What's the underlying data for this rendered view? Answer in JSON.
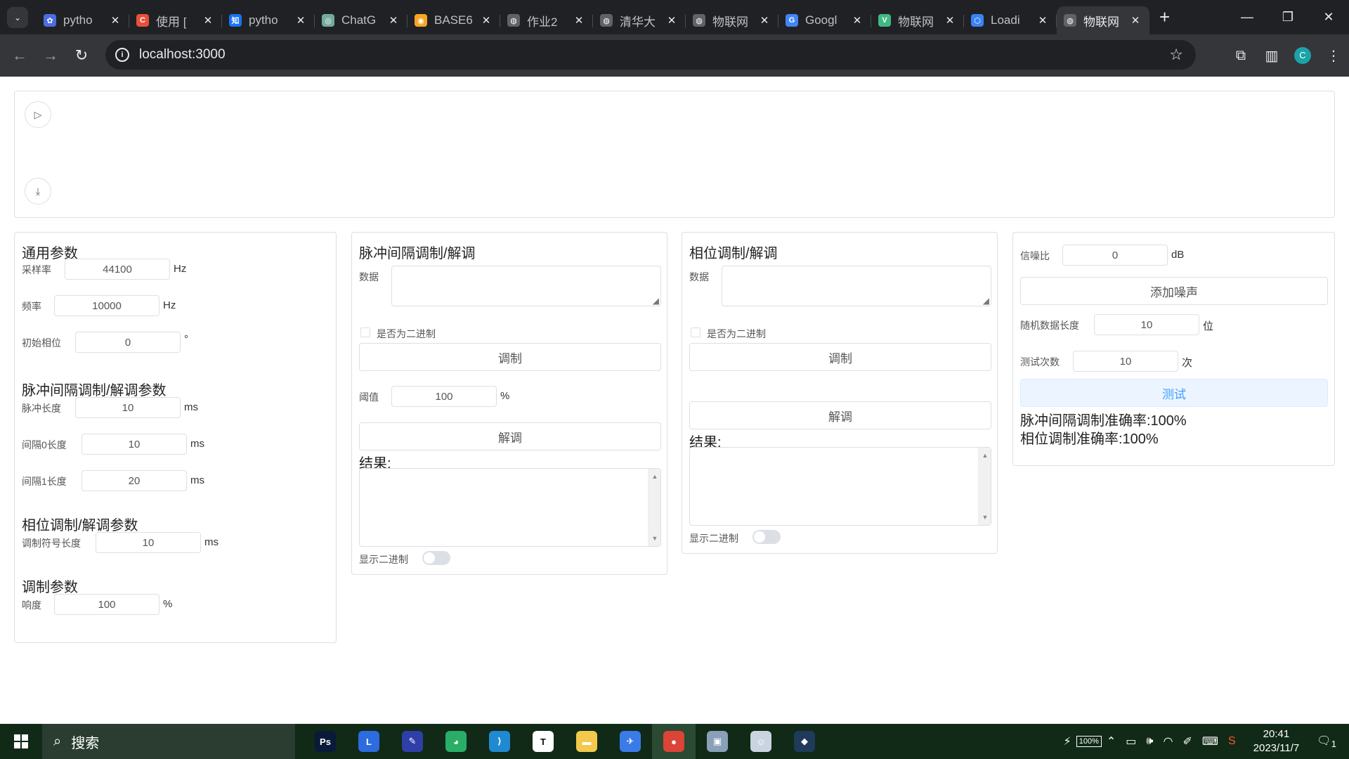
{
  "browser": {
    "tabs": [
      {
        "title": "pytho",
        "icon": "python-icon",
        "color": "#4a6ee0",
        "glyph": "✿",
        "active": false
      },
      {
        "title": "使用 [",
        "icon": "csdn-icon",
        "color": "#e8503a",
        "glyph": "C",
        "active": false
      },
      {
        "title": "pytho",
        "icon": "zhihu-icon",
        "color": "#1772f6",
        "glyph": "知",
        "active": false
      },
      {
        "title": "ChatG",
        "icon": "chatgpt-icon",
        "color": "#74aa9c",
        "glyph": "◎",
        "active": false
      },
      {
        "title": "BASE6",
        "icon": "base64-icon",
        "color": "#f5a623",
        "glyph": "◉",
        "active": false
      },
      {
        "title": "作业2",
        "icon": "globe-icon",
        "color": "#5f6368",
        "glyph": "◍",
        "active": false
      },
      {
        "title": "清华大",
        "icon": "globe-icon",
        "color": "#5f6368",
        "glyph": "◍",
        "active": false
      },
      {
        "title": "物联网",
        "icon": "globe-icon",
        "color": "#5f6368",
        "glyph": "◍",
        "active": false
      },
      {
        "title": "Googl",
        "icon": "google-translate-icon",
        "color": "#4285f4",
        "glyph": "G",
        "active": false
      },
      {
        "title": "物联网",
        "icon": "vue-icon",
        "color": "#41b883",
        "glyph": "V",
        "active": false
      },
      {
        "title": "Loadi",
        "icon": "loading-icon",
        "color": "#3b82f6",
        "glyph": "⬡",
        "active": false
      },
      {
        "title": "物联网",
        "icon": "globe-icon",
        "color": "#5f6368",
        "glyph": "◍",
        "active": true
      }
    ],
    "url": "localhost:3000",
    "profile_initial": "C"
  },
  "general": {
    "title": "通用参数",
    "sample_rate_label": "采样率",
    "sample_rate": "44100",
    "sample_rate_unit": "Hz",
    "freq_label": "频率",
    "freq": "10000",
    "freq_unit": "Hz",
    "phase_label": "初始相位",
    "phase": "0",
    "phase_unit": "°",
    "pulse_title": "脉冲间隔调制/解调参数",
    "pulse_len_label": "脉冲长度",
    "pulse_len": "10",
    "pulse_len_unit": "ms",
    "gap0_label": "间隔0长度",
    "gap0": "10",
    "gap0_unit": "ms",
    "gap1_label": "间隔1长度",
    "gap1": "20",
    "gap1_unit": "ms",
    "phase_title": "相位调制/解调参数",
    "sym_len_label": "调制符号长度",
    "sym_len": "10",
    "sym_len_unit": "ms",
    "mod_title": "调制参数",
    "loud_label": "响度",
    "loud": "100",
    "loud_unit": "%"
  },
  "pulse": {
    "title": "脉冲间隔调制/解调",
    "data_label": "数据",
    "binary_label": "是否为二进制",
    "mod_btn": "调制",
    "thresh_label": "阈值",
    "thresh": "100",
    "thresh_unit": "%",
    "demod_btn": "解调",
    "result_label": "结果:",
    "show_binary": "显示二进制"
  },
  "phase": {
    "title": "相位调制/解调",
    "data_label": "数据",
    "binary_label": "是否为二进制",
    "mod_btn": "调制",
    "demod_btn": "解调",
    "result_label": "结果:",
    "show_binary": "显示二进制"
  },
  "test": {
    "snr_label": "信噪比",
    "snr": "0",
    "snr_unit": "dB",
    "add_noise_btn": "添加噪声",
    "rand_len_label": "随机数据长度",
    "rand_len": "10",
    "rand_len_unit": "位",
    "count_label": "测试次数",
    "count": "10",
    "count_unit": "次",
    "test_btn": "测试",
    "pulse_acc": "脉冲间隔调制准确率:100%",
    "phase_acc": "相位调制准确率:100%"
  },
  "taskbar": {
    "search": "搜索",
    "apps": [
      {
        "name": "photoshop-icon",
        "color": "#0a1a3a",
        "glyph": "Ps",
        "active": false
      },
      {
        "name": "lark-icon",
        "color": "#2c6be0",
        "glyph": "L",
        "active": false
      },
      {
        "name": "pen-icon",
        "color": "#2f3fa8",
        "glyph": "✎",
        "active": false
      },
      {
        "name": "wechat-icon",
        "color": "#2aae67",
        "glyph": "◕",
        "active": false
      },
      {
        "name": "vscode-icon",
        "color": "#1f8ad2",
        "glyph": "⟩",
        "active": false
      },
      {
        "name": "typora-icon",
        "color": "#ffffff",
        "glyph": "T",
        "active": false
      },
      {
        "name": "file-explorer-icon",
        "color": "#f2c94c",
        "glyph": "▬",
        "active": false
      },
      {
        "name": "feishu-icon",
        "color": "#3a7be8",
        "glyph": "✈",
        "active": false
      },
      {
        "name": "chrome-icon",
        "color": "#db4437",
        "glyph": "●",
        "active": true
      },
      {
        "name": "image-viewer-icon",
        "color": "#8aa0b8",
        "glyph": "▣",
        "active": false
      },
      {
        "name": "avatar-app-icon",
        "color": "#c9d4e0",
        "glyph": "☺",
        "active": false
      },
      {
        "name": "game-app-icon",
        "color": "#1f3a5a",
        "glyph": "◆",
        "active": false
      }
    ],
    "battery": "100%",
    "time": "20:41",
    "date": "2023/11/7",
    "notifications": "1"
  }
}
